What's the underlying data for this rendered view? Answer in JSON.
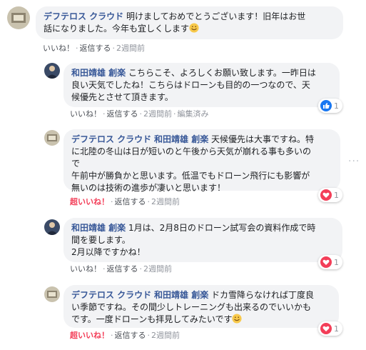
{
  "comments": [
    {
      "author": "デフテロス クラウド",
      "line1": "明けましておめでとうございます！旧年はお世",
      "line2": "話になりました。今年も宜しくします",
      "emoji": "smile-emoji",
      "like": "いいね！",
      "reply": "返信する",
      "time": "2週間前"
    },
    {
      "author": "和田靖雄 創楽",
      "text_first": "こちらこそ、よろしくお願い致します。一昨日は",
      "lines": [
        "良い天気でしたね！こちらはドローンも目的の一つなので、天",
        "候優先とさせて頂きます。"
      ],
      "like": "いいね！",
      "reply": "返信する",
      "time": "2週間前",
      "edited": "編集済み",
      "reaction_count": "1",
      "reaction_icon": "like-icon"
    },
    {
      "author": "デフテロス クラウド",
      "mention": "和田靖雄 創楽",
      "text_first": "天候優先は大事ですね。特",
      "lines": [
        "に北陸の冬山は日が短いのと午後から天気が崩れる事も多いの",
        "で",
        "午前中が勝負かと思います。低温でもドローン飛行にも影響が",
        "無いのは技術の進歩が凄いと思います！"
      ],
      "like": "超いいね！",
      "reply": "返信する",
      "time": "2週間前",
      "reaction_count": "1",
      "reaction_icon": "love-icon"
    },
    {
      "author": "和田靖雄 創楽",
      "text_first": "1月は、2月8日のドローン試写会の資料作成で時",
      "lines": [
        "間を要します。",
        "2月以降ですかね！"
      ],
      "like": "いいね！",
      "reply": "返信する",
      "time": "2週間前",
      "reaction_count": "1",
      "reaction_icon": "love-icon"
    },
    {
      "author": "デフテロス クラウド",
      "mention": "和田靖雄 創楽",
      "text_first": "ドカ雪降らなければ丁度良",
      "lines": [
        "い季節ですね。その間少しトレーニングも出来るのでいいかも",
        "です。一度ドローンも拝見してみたいです"
      ],
      "emoji": "smile-emoji",
      "like": "超いいね！",
      "reply": "返信する",
      "time": "2週間前",
      "reaction_count": "1",
      "reaction_icon": "love-icon"
    }
  ],
  "colors": {
    "link": "#385898",
    "bubble": "#f2f3f5",
    "super_like": "#f33e58",
    "like_blue": "#1877f2"
  }
}
